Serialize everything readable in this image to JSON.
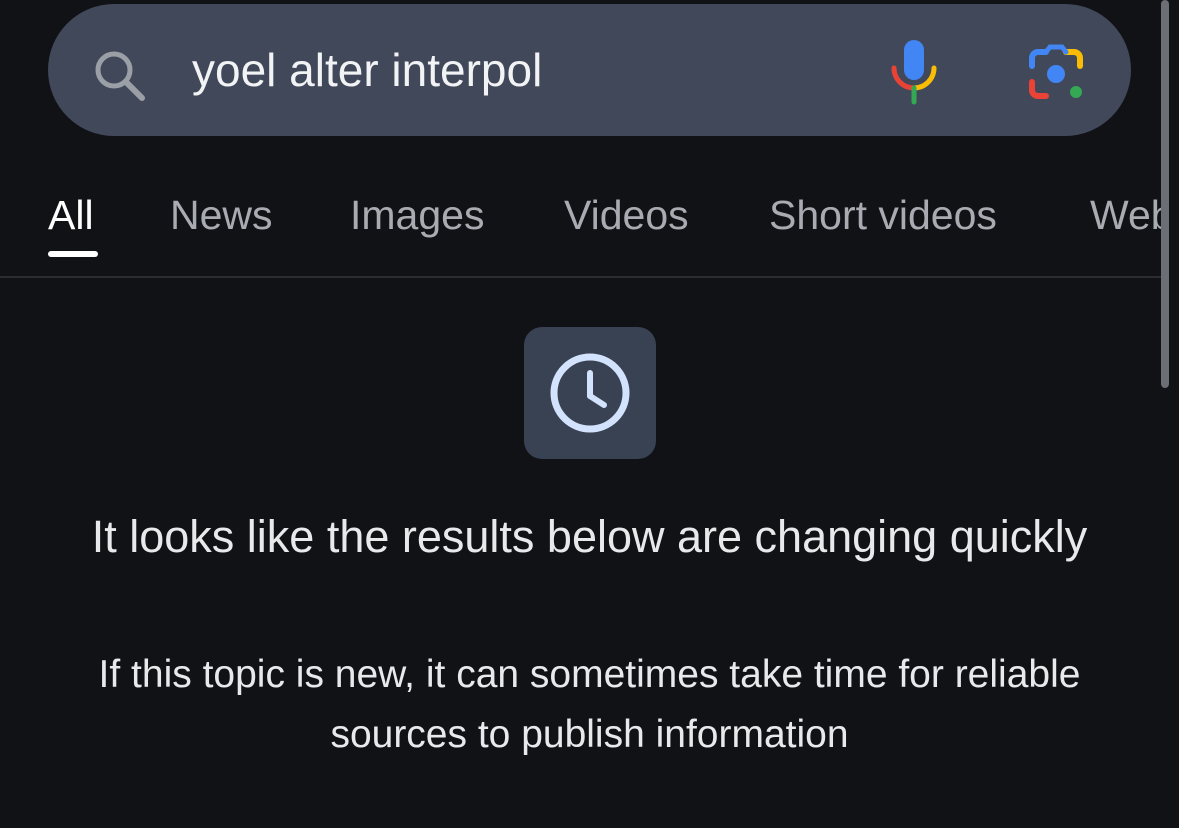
{
  "search": {
    "query": "yoel alter interpol"
  },
  "tabs": [
    {
      "label": "All",
      "active": true
    },
    {
      "label": "News"
    },
    {
      "label": "Images"
    },
    {
      "label": "Videos"
    },
    {
      "label": "Short videos"
    },
    {
      "label": "Web"
    }
  ],
  "notice": {
    "icon": "clock-icon",
    "title": "It looks like the results below are changing quickly",
    "body": "If this topic is new, it can sometimes take time for reliable sources to publish information"
  },
  "colors": {
    "background": "#111216",
    "search_bar": "#41485a",
    "icon_box": "#394253",
    "clock": "#d3e3fd",
    "mic_blue": "#4285f4",
    "mic_red": "#ea4335",
    "mic_yellow": "#fbbc04",
    "mic_green": "#34a853"
  }
}
